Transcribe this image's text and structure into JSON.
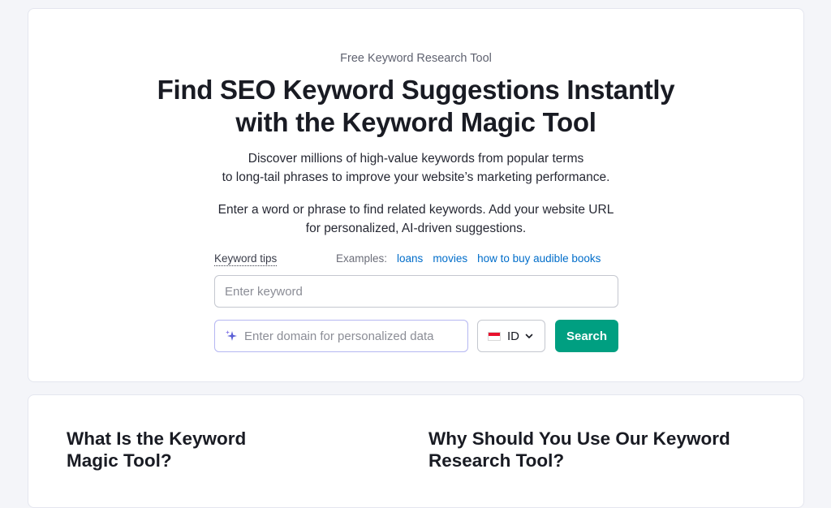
{
  "hero": {
    "eyebrow": "Free Keyword Research Tool",
    "title_line1": "Find SEO Keyword Suggestions Instantly",
    "title_line2": "with the Keyword Magic Tool",
    "desc1_line1": "Discover millions of high-value keywords from popular terms",
    "desc1_line2": "to long-tail phrases to improve your website’s marketing performance.",
    "desc2_line1": "Enter a word or phrase to find related keywords. Add your website URL",
    "desc2_line2": "for personalized, AI-driven suggestions."
  },
  "search": {
    "keyword_tips": "Keyword tips",
    "examples_label": "Examples:",
    "examples": [
      "loans",
      "movies",
      "how to buy audible books"
    ],
    "keyword_placeholder": "Enter keyword",
    "domain_placeholder": "Enter domain for personalized data",
    "country": "ID",
    "button": "Search"
  },
  "info": {
    "left_line1": "What Is the Keyword",
    "left_line2": "Magic Tool?",
    "right_line1": "Why Should You Use Our Keyword",
    "right_line2": "Research Tool?"
  },
  "colors": {
    "accent": "#009f81",
    "link": "#006dca",
    "ai_border": "#b5b7f2"
  }
}
